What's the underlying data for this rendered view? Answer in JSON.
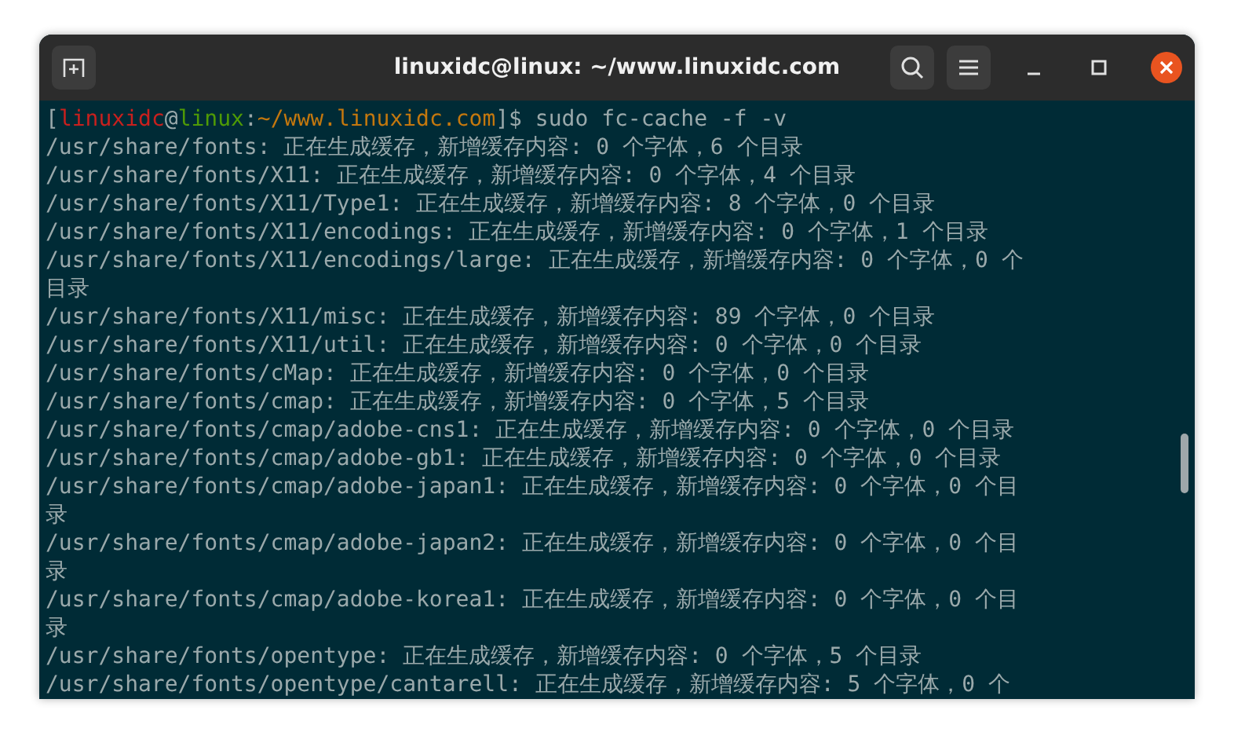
{
  "window": {
    "title": "linuxidc@linux: ~/www.linuxidc.com"
  },
  "terminal": {
    "prompt": [
      {
        "text": "[",
        "color": "#9aa9ab"
      },
      {
        "text": "linuxidc",
        "color": "#c8201e"
      },
      {
        "text": "@",
        "color": "#9aa9ab"
      },
      {
        "text": "linux",
        "color": "#4e9a06"
      },
      {
        "text": ":",
        "color": "#9aa9ab"
      },
      {
        "text": "~/www.linuxidc.com",
        "color": "#c4780e"
      },
      {
        "text": "]$ ",
        "color": "#9aa9ab"
      }
    ],
    "command": "sudo fc-cache -f -v",
    "output": [
      "/usr/share/fonts: 正在生成缓存，新增缓存内容: 0 个字体，6 个目录",
      "/usr/share/fonts/X11: 正在生成缓存，新增缓存内容: 0 个字体，4 个目录",
      "/usr/share/fonts/X11/Type1: 正在生成缓存，新增缓存内容: 8 个字体，0 个目录",
      "/usr/share/fonts/X11/encodings: 正在生成缓存，新增缓存内容: 0 个字体，1 个目录",
      "/usr/share/fonts/X11/encodings/large: 正在生成缓存，新增缓存内容: 0 个字体，0 个目录",
      "/usr/share/fonts/X11/misc: 正在生成缓存，新增缓存内容: 89 个字体，0 个目录",
      "/usr/share/fonts/X11/util: 正在生成缓存，新增缓存内容: 0 个字体，0 个目录",
      "/usr/share/fonts/cMap: 正在生成缓存，新增缓存内容: 0 个字体，0 个目录",
      "/usr/share/fonts/cmap: 正在生成缓存，新增缓存内容: 0 个字体，5 个目录",
      "/usr/share/fonts/cmap/adobe-cns1: 正在生成缓存，新增缓存内容: 0 个字体，0 个目录",
      "/usr/share/fonts/cmap/adobe-gb1: 正在生成缓存，新增缓存内容: 0 个字体，0 个目录",
      "/usr/share/fonts/cmap/adobe-japan1: 正在生成缓存，新增缓存内容: 0 个字体，0 个目录",
      "/usr/share/fonts/cmap/adobe-japan2: 正在生成缓存，新增缓存内容: 0 个字体，0 个目录",
      "/usr/share/fonts/cmap/adobe-korea1: 正在生成缓存，新增缓存内容: 0 个字体，0 个目录",
      "/usr/share/fonts/opentype: 正在生成缓存，新增缓存内容: 0 个字体，5 个目录",
      "/usr/share/fonts/opentype/cantarell: 正在生成缓存，新增缓存内容: 5 个字体，0 个"
    ]
  }
}
